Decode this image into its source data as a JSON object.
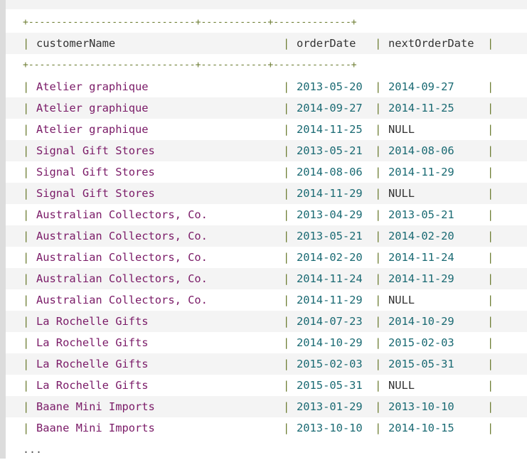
{
  "table": {
    "border": "+------------------------------+------------+--------------+",
    "headers": {
      "customer_name": "customerName",
      "order_date": "orderDate",
      "next_order_date": "nextOrderDate"
    },
    "rows": [
      {
        "customerName": "Atelier graphique",
        "orderDate": "2013-05-20",
        "nextOrderDate": "2014-09-27"
      },
      {
        "customerName": "Atelier graphique",
        "orderDate": "2014-09-27",
        "nextOrderDate": "2014-11-25"
      },
      {
        "customerName": "Atelier graphique",
        "orderDate": "2014-11-25",
        "nextOrderDate": "NULL"
      },
      {
        "customerName": "Signal Gift Stores",
        "orderDate": "2013-05-21",
        "nextOrderDate": "2014-08-06"
      },
      {
        "customerName": "Signal Gift Stores",
        "orderDate": "2014-08-06",
        "nextOrderDate": "2014-11-29"
      },
      {
        "customerName": "Signal Gift Stores",
        "orderDate": "2014-11-29",
        "nextOrderDate": "NULL"
      },
      {
        "customerName": "Australian Collectors, Co.",
        "orderDate": "2013-04-29",
        "nextOrderDate": "2013-05-21"
      },
      {
        "customerName": "Australian Collectors, Co.",
        "orderDate": "2013-05-21",
        "nextOrderDate": "2014-02-20"
      },
      {
        "customerName": "Australian Collectors, Co.",
        "orderDate": "2014-02-20",
        "nextOrderDate": "2014-11-24"
      },
      {
        "customerName": "Australian Collectors, Co.",
        "orderDate": "2014-11-24",
        "nextOrderDate": "2014-11-29"
      },
      {
        "customerName": "Australian Collectors, Co.",
        "orderDate": "2014-11-29",
        "nextOrderDate": "NULL"
      },
      {
        "customerName": "La Rochelle Gifts",
        "orderDate": "2014-07-23",
        "nextOrderDate": "2014-10-29"
      },
      {
        "customerName": "La Rochelle Gifts",
        "orderDate": "2014-10-29",
        "nextOrderDate": "2015-02-03"
      },
      {
        "customerName": "La Rochelle Gifts",
        "orderDate": "2015-02-03",
        "nextOrderDate": "2015-05-31"
      },
      {
        "customerName": "La Rochelle Gifts",
        "orderDate": "2015-05-31",
        "nextOrderDate": "NULL"
      },
      {
        "customerName": "Baane Mini Imports",
        "orderDate": "2013-01-29",
        "nextOrderDate": "2013-10-10"
      },
      {
        "customerName": "Baane Mini Imports",
        "orderDate": "2013-10-10",
        "nextOrderDate": "2014-10-15"
      }
    ],
    "ellipsis": "...",
    "pipe": "|",
    "colors": {
      "border": "#6d7d32",
      "name": "#7a1a67",
      "date": "#1a6a73",
      "plain": "#333333"
    }
  }
}
